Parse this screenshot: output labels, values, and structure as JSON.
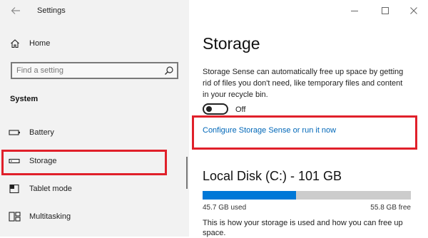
{
  "window": {
    "title": "Settings",
    "back_icon": "back-arrow-icon",
    "controls": [
      "minimize-icon",
      "maximize-icon",
      "close-icon"
    ]
  },
  "sidebar": {
    "home": {
      "label": "Home",
      "icon": "home-icon"
    },
    "search": {
      "placeholder": "Find a setting",
      "icon": "search-icon"
    },
    "section_heading": "System",
    "items": [
      {
        "label": "Battery",
        "icon": "battery-icon"
      },
      {
        "label": "Storage",
        "icon": "storage-icon",
        "selected": true
      },
      {
        "label": "Tablet mode",
        "icon": "tablet-mode-icon"
      },
      {
        "label": "Multitasking",
        "icon": "multitasking-icon"
      }
    ]
  },
  "main": {
    "title": "Storage",
    "description": "Storage Sense can automatically free up space by getting rid of files you don't need, like temporary files and content in your recycle bin.",
    "toggle": {
      "state_label": "Off",
      "on": false
    },
    "configure_link": "Configure Storage Sense or run it now",
    "disk": {
      "title": "Local Disk (C:) - 101 GB",
      "used_label": "45.7 GB used",
      "free_label": "55.8 GB free",
      "used_fraction": 0.45
    },
    "bottom_text": "This is how your storage is used and how you can free up space."
  },
  "colors": {
    "highlight": "#e0202a",
    "accent": "#0078d7",
    "link": "#0067b8"
  }
}
